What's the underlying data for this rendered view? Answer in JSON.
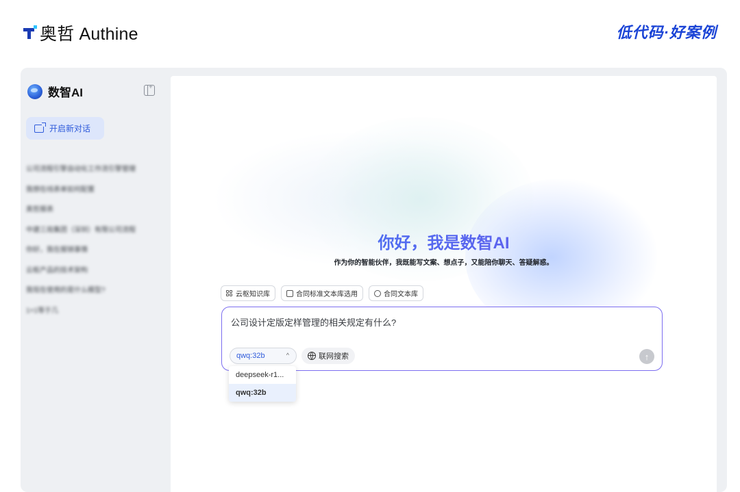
{
  "brand": {
    "name": "奥哲 Authine",
    "slogan": "低代码·好案例"
  },
  "sidebar": {
    "app_title": "数智AI",
    "new_chat_label": "开启新对话",
    "history": [
      "公司流程引擎自动化工作流引擎管理",
      "我想在线表单如何配置",
      "奥哲报表",
      "中建三局集团（深圳）有限公司流程",
      "你好，我在报销事情",
      "云枢产品的技术架构",
      "我现在使用的是什么模型?",
      "1+1等于几"
    ]
  },
  "main": {
    "hero_title": "你好，我是数智AI",
    "hero_subtitle": "作为你的智能伙伴，我既能写文案、想点子，又能陪你聊天、答疑解惑。",
    "chips": [
      {
        "label": "云枢知识库",
        "icon": "grid-icon"
      },
      {
        "label": "合同标准文本库选用",
        "icon": "stack-icon"
      },
      {
        "label": "合同文本库",
        "icon": "recycle-icon"
      }
    ],
    "input_value": "公司设计定版定样管理的相关规定有什么?",
    "model": {
      "selected": "qwq:32b",
      "options": [
        "deepseek-r1...",
        "qwq:32b"
      ]
    },
    "web_search_label": "联网搜索",
    "send_icon": "↑"
  },
  "colors": {
    "accent": "#2f5bdb",
    "input_border": "#7b6df0",
    "title_gradient_start": "#3d7ef5",
    "title_gradient_end": "#7a5cf0"
  }
}
